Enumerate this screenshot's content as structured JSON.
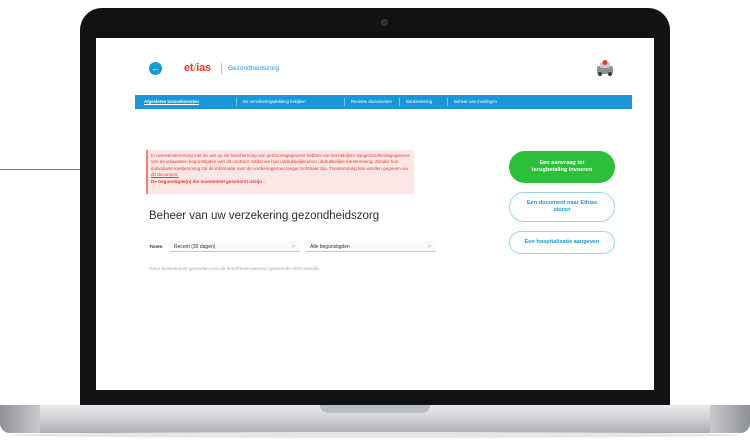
{
  "header": {
    "back_icon": "arrow-left-icon",
    "logo": {
      "part1": "et",
      "slash": "/",
      "part2": "ias"
    },
    "product": "Gezondheidszorg",
    "avatar_icon": "profile-avatar-icon"
  },
  "nav": {
    "items": [
      {
        "label": "Afgesloten tussenkomsten",
        "active": true
      },
      {
        "label": "De verzekeringsdekking bekijken"
      },
      {
        "label": "Recente documenten"
      },
      {
        "label": "Bankrekening"
      },
      {
        "label": "Beheer van meldingen"
      }
    ]
  },
  "alert": {
    "body_pre": "In overeenstemming met de wet op de bescherming van persoonsgegevens hebben we het bekijken vangezondheidsgegevens van de volwassen begunstigden van dit contract, totdat we hun uitdrukkelijkeuhun uitdrukkelijke toestemming. Zonder hun individuele toestemming zal de informatie over de vordieringennet langer zichtbaar zijn. Toestemming kan worden gegeven via ",
    "link": "dit document.",
    "strong": "De begunstigde(n) die momenteel geschorst is/zijn :"
  },
  "main": {
    "title": "Beheer van uw verzekering gezondheidszorg",
    "filter_label": "Tonen",
    "period_select": {
      "value": "Recent (30 dagen)"
    },
    "person_select": {
      "value": "Alle begunstigden"
    },
    "chevron_icon": "chevron-down-icon",
    "empty_message": "Geen tussenkomst gevonden voor de betreffende persoon gedurende deze periode."
  },
  "actions": {
    "primary": "Een aanvraag tot terugbetaling invoeren",
    "send_document": "Een document naar Ethias sturen",
    "hospitalization": "Een hospitalisatie aangeven"
  },
  "colors": {
    "brand_blue": "#1a97d8",
    "brand_red": "#e03c31",
    "success_green": "#2cbf39",
    "alert_bg": "#fde7e6",
    "pointer": "#e35d3b"
  }
}
